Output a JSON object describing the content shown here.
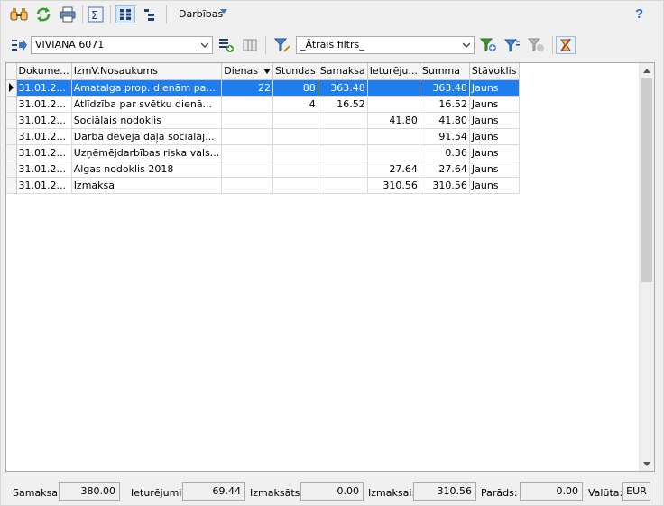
{
  "toolbar": {
    "actions_label": "Darbības",
    "help_label": "?"
  },
  "filterbar": {
    "employee_value": "VIVIANA 6071",
    "quick_filter_value": "_Ātrais filtrs_"
  },
  "grid": {
    "columns": [
      "Dokume...",
      "IzmV.Nosaukums",
      "Dienas",
      "Stundas",
      "Samaksa",
      "Ieturēju...",
      "Summa",
      "Stāvoklis"
    ],
    "rows": [
      [
        "31.01.2...",
        "Amatalga prop. dienām pa...",
        "22",
        "88",
        "363.48",
        "",
        "363.48",
        "Jauns"
      ],
      [
        "31.01.2...",
        "Atlīdzība par svētku dienā...",
        "",
        "4",
        "16.52",
        "",
        "16.52",
        "Jauns"
      ],
      [
        "31.01.2...",
        "Sociālais nodoklis",
        "",
        "",
        "",
        "41.80",
        "41.80",
        "Jauns"
      ],
      [
        "31.01.2...",
        "Darba devēja daļa sociālaj...",
        "",
        "",
        "",
        "",
        "91.54",
        "Jauns"
      ],
      [
        "31.01.2...",
        "Uzņēmējdarbības riska vals...",
        "",
        "",
        "",
        "",
        "0.36",
        "Jauns"
      ],
      [
        "31.01.2...",
        "Algas nodoklis 2018",
        "",
        "",
        "",
        "27.64",
        "27.64",
        "Jauns"
      ],
      [
        "31.01.2...",
        "Izmaksa",
        "",
        "",
        "",
        "310.56",
        "310.56",
        "Jauns"
      ]
    ]
  },
  "status": {
    "samaksa_label": "Samaksa:",
    "samaksa_value": "380.00",
    "ieturejumi_label": "Ieturējumi:",
    "ieturejumi_value": "69.44",
    "izmaksats_label": "Izmaksāts:",
    "izmaksats_value": "0.00",
    "izmaksai_label": "Izmaksai:",
    "izmaksai_value": "310.56",
    "parads_label": "Parāds:",
    "parads_value": "0.00",
    "valuta_label": "Valūta:",
    "valuta_value": "EUR"
  }
}
